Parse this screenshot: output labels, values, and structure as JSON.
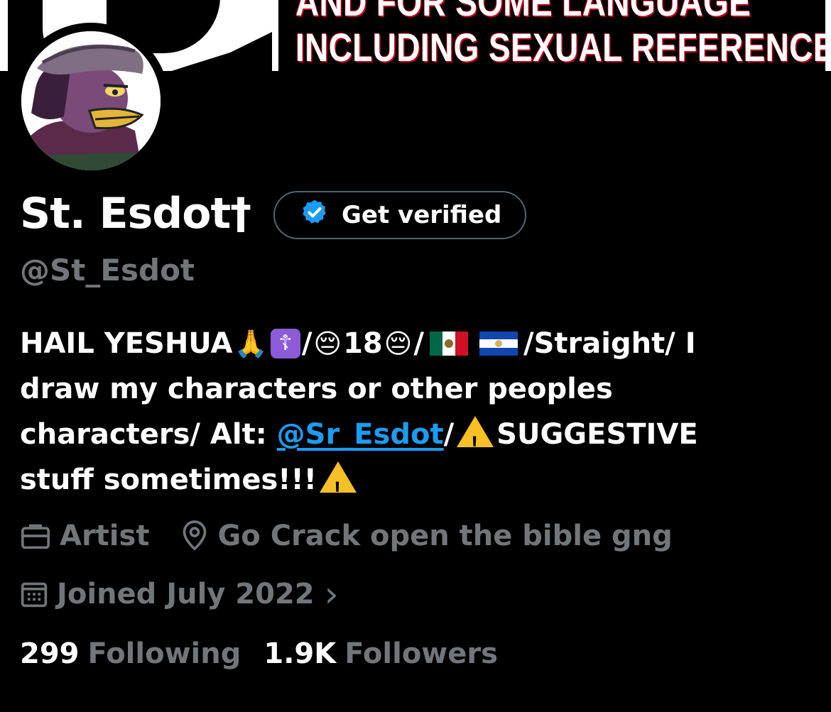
{
  "banner": {
    "rating_line1": "AND FOR SOME LANGUAGE",
    "rating_line2": "INCLUDING SEXUAL REFERENCES."
  },
  "profile": {
    "name": "St. Esdot†",
    "handle": "@St_Esdot",
    "verify_button": "Get verified",
    "avatar_icon": "avatar-drawing"
  },
  "bio": {
    "line1_a": "HAIL YESHUA",
    "line1_slash1": "/",
    "line1_age": "18",
    "line1_slash2": "/",
    "line1_tail": "/Straight/ I",
    "line2": "draw my characters or other peoples",
    "line3_a": "characters/ Alt: ",
    "line3_mention": "@Sr_Esdot",
    "line3_b": "/",
    "line3_c": "SUGGESTIVE",
    "line4": "stuff sometimes!!!",
    "emoji": {
      "pray": "🙏",
      "cross": "☦",
      "face": "😔"
    }
  },
  "meta": {
    "profession": "Artist",
    "location": "Go Crack open the bible gng",
    "joined": "Joined July 2022",
    "chevron": "›"
  },
  "stats": {
    "following_count": "299",
    "following_label": "Following",
    "followers_count": "1.9K",
    "followers_label": "Followers"
  },
  "colors": {
    "background": "#000000",
    "text": "#ffffff",
    "muted": "#71767b",
    "link": "#1d9bf0",
    "verified": "#1d9bf0"
  }
}
